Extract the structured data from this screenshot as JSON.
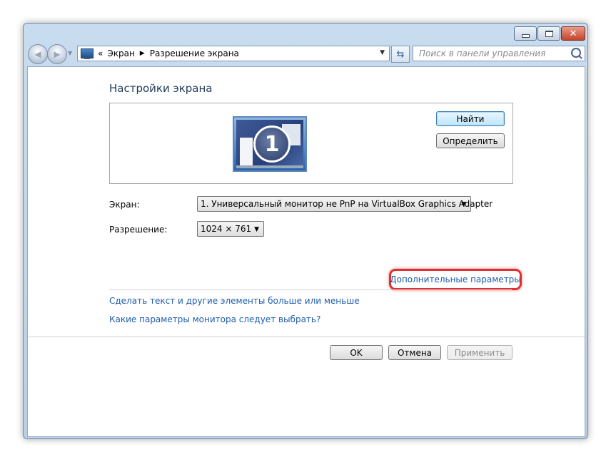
{
  "window": {
    "controls": {
      "minimize": "minimize",
      "maximize": "maximize",
      "close": "✕"
    }
  },
  "navbar": {
    "back_icon": "◀",
    "forward_icon": "▶",
    "address_overflow": "«",
    "breadcrumbs": [
      "Экран",
      "Разрешение экрана"
    ],
    "search_placeholder": "Поиск в панели управления"
  },
  "main": {
    "title": "Настройки экрана",
    "monitor_number": "1",
    "find_button": "Найти",
    "identify_button": "Определить",
    "display_label": "Экран:",
    "display_value": "1. Универсальный монитор не PnP на VirtualBox Graphics Adapter",
    "resolution_label": "Разрешение:",
    "resolution_value": "1024 × 761",
    "advanced_link": "Дополнительные параметры",
    "text_size_link": "Сделать текст и другие элементы больше или меньше",
    "monitor_help_link": "Какие параметры монитора следует выбрать?"
  },
  "footer": {
    "ok_button": "OK",
    "cancel_button": "Отмена",
    "apply_button": "Применить"
  },
  "colors": {
    "link": "#1d5cac",
    "title": "#1e395b",
    "highlight": "#e23030"
  }
}
